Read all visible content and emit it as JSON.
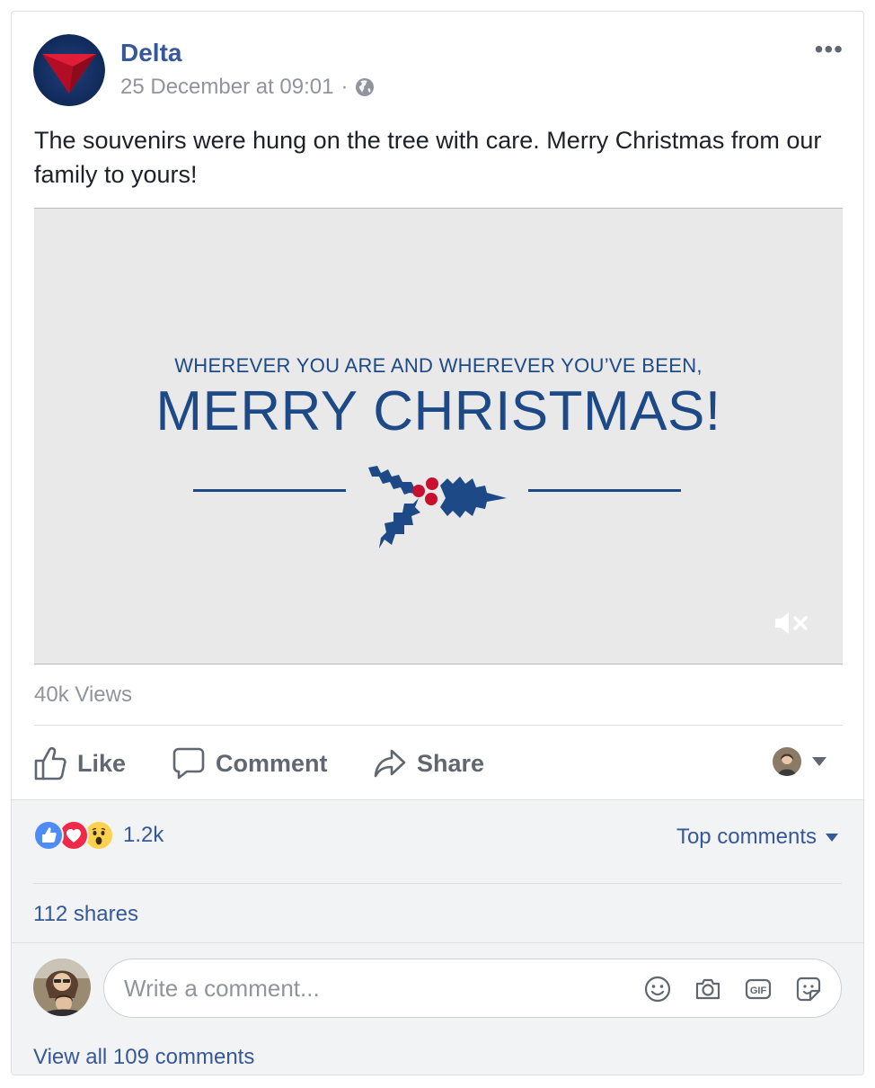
{
  "post": {
    "page_name": "Delta",
    "timestamp": "25 December at 09:01",
    "separator": "·",
    "privacy_icon": "globe-icon",
    "more_icon": "more-options-icon",
    "more_label": "•••",
    "text": "The souvenirs were hung on the tree with care. Merry Christmas from our family to yours!"
  },
  "video": {
    "subtitle": "WHEREVER YOU ARE AND WHEREVER YOU’VE BEEN,",
    "title": "MERRY CHRISTMAS!",
    "mute_icon": "muted-speaker-icon",
    "views": "40k Views"
  },
  "actions": {
    "like": "Like",
    "comment": "Comment",
    "share": "Share"
  },
  "engagement": {
    "reactions": [
      "like",
      "love",
      "wow"
    ],
    "reaction_count": "1.2k",
    "top_comments": "Top comments",
    "shares": "112 shares"
  },
  "composer": {
    "placeholder": "Write a comment...",
    "tools": [
      "emoji-icon",
      "camera-icon",
      "gif-icon",
      "sticker-icon"
    ]
  },
  "comments": {
    "view_all": "View all 109 comments"
  },
  "colors": {
    "link_blue": "#365899",
    "delta_navy": "#1d4a86",
    "delta_red": "#c8102e",
    "gray_text": "#90949c",
    "like_blue": "#4d8cf5",
    "love_red": "#f0284a",
    "wow_yellow": "#fcd24d"
  }
}
